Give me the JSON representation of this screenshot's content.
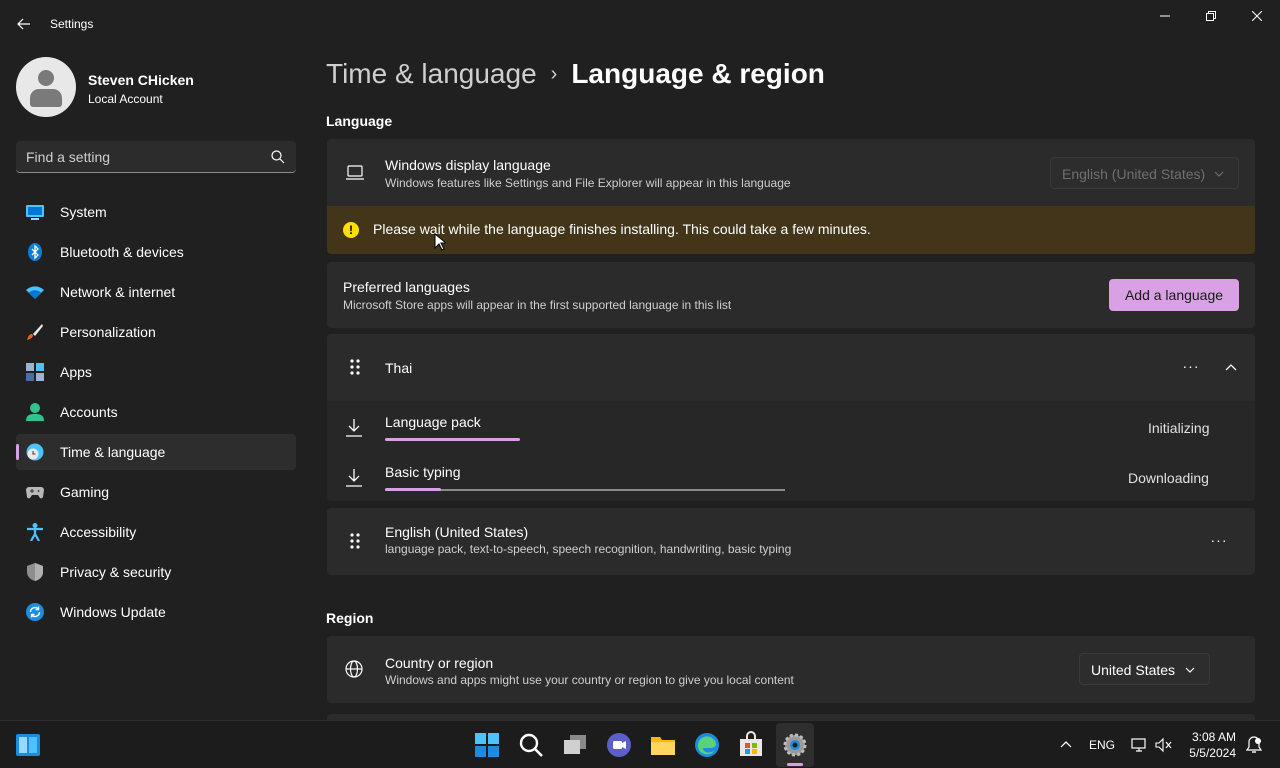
{
  "window": {
    "title": "Settings"
  },
  "profile": {
    "name": "Steven CHicken",
    "account_type": "Local Account"
  },
  "search": {
    "placeholder": "Find a setting"
  },
  "sidebar": {
    "items": [
      {
        "label": "System",
        "icon": "system-icon"
      },
      {
        "label": "Bluetooth & devices",
        "icon": "bluetooth-icon"
      },
      {
        "label": "Network & internet",
        "icon": "wifi-icon"
      },
      {
        "label": "Personalization",
        "icon": "brush-icon"
      },
      {
        "label": "Apps",
        "icon": "apps-icon"
      },
      {
        "label": "Accounts",
        "icon": "accounts-icon"
      },
      {
        "label": "Time & language",
        "icon": "time-language-icon",
        "selected": true
      },
      {
        "label": "Gaming",
        "icon": "gamepad-icon"
      },
      {
        "label": "Accessibility",
        "icon": "accessibility-icon"
      },
      {
        "label": "Privacy & security",
        "icon": "shield-icon"
      },
      {
        "label": "Windows Update",
        "icon": "update-icon"
      }
    ]
  },
  "breadcrumb": {
    "parent": "Time & language",
    "separator": "›",
    "current": "Language & region"
  },
  "language_section": {
    "title": "Language",
    "display_language": {
      "title": "Windows display language",
      "subtitle": "Windows features like Settings and File Explorer will appear in this language",
      "selected": "English (United States)"
    },
    "warning": "Please wait while the language finishes installing. This could take a few minutes.",
    "preferred": {
      "title": "Preferred languages",
      "subtitle": "Microsoft Store apps will appear in the first supported language in this list",
      "add_button": "Add a language"
    },
    "thai": {
      "name": "Thai",
      "more": "···",
      "items": [
        {
          "label": "Language pack",
          "status": "Initializing",
          "progress": 0.34
        },
        {
          "label": "Basic typing",
          "status": "Downloading",
          "progress": 0.14
        }
      ]
    },
    "english": {
      "name": "English (United States)",
      "features": "language pack, text-to-speech, speech recognition, handwriting, basic typing",
      "more": "···"
    }
  },
  "region_section": {
    "title": "Region",
    "country": {
      "title": "Country or region",
      "subtitle": "Windows and apps might use your country or region to give you local content",
      "selected": "United States"
    }
  },
  "taskbar": {
    "language": "ENG",
    "time": "3:08 AM",
    "date": "5/5/2024"
  },
  "colors": {
    "accent": "#d9a0e3",
    "background": "#202020",
    "card": "#2b2b2b",
    "warning_bg": "#433519",
    "warning_icon": "#fce100"
  }
}
